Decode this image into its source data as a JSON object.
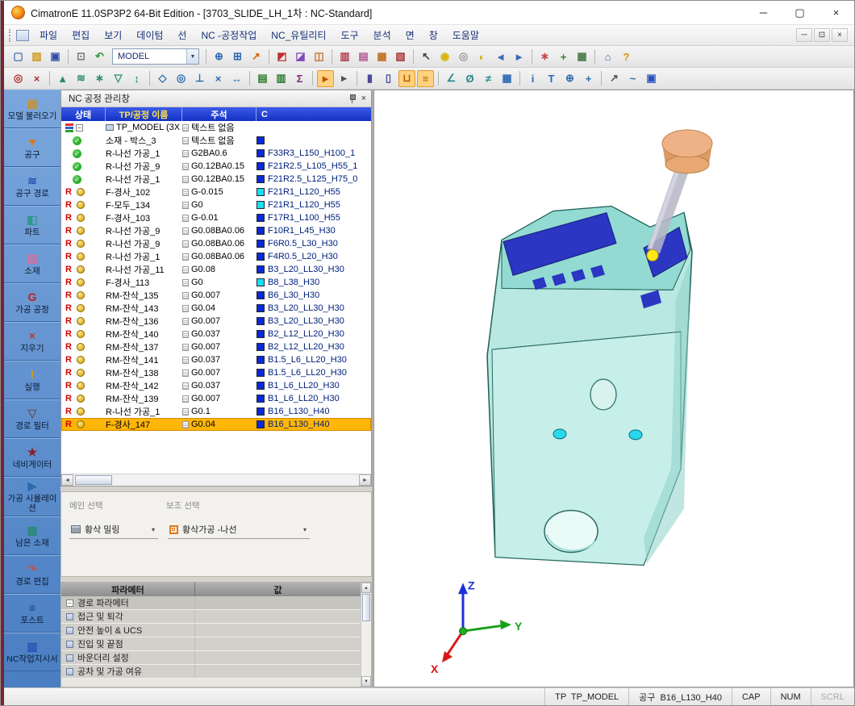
{
  "window": {
    "title": "CimatronE 11.0SP3P2 64-Bit Edition - [3703_SLIDE_LH_1차 : NC-Standard]"
  },
  "icons": {
    "minimize": "─",
    "maximize": "▢",
    "restore": "⊡",
    "close": "×",
    "dropdown": "▼",
    "dropdown_small": "▾",
    "left": "◄",
    "right": "►",
    "up": "▲",
    "down": "▼",
    "collapse": "−",
    "check": "✓"
  },
  "menu": {
    "items": [
      "파일",
      "편집",
      "보기",
      "데이텀",
      "선",
      "NC -공정작업",
      "NC_유틸리티",
      "도구",
      "분석",
      "면",
      "창",
      "도움말"
    ]
  },
  "toolbars": {
    "model_value": "MODEL",
    "row1": [
      {
        "n": "new-file-icon",
        "g": "▢",
        "c": "#4a6fb5"
      },
      {
        "n": "open-file-icon",
        "g": "▨",
        "c": "#d09818"
      },
      {
        "n": "save-icon",
        "g": "▣",
        "c": "#2e4fa8"
      },
      {
        "sep": true
      },
      {
        "n": "print-icon",
        "g": "⊡",
        "c": "#777777"
      },
      {
        "n": "undo-icon",
        "g": "↶",
        "c": "#2f9e3f"
      },
      {
        "combo": true
      },
      {
        "sep": true
      },
      {
        "n": "zoom-fit-icon",
        "g": "⊕",
        "c": "#2a6ab0"
      },
      {
        "n": "zoom-window-icon",
        "g": "⊞",
        "c": "#2a6ab0"
      },
      {
        "n": "zoom-dynamic-icon",
        "g": "↗",
        "c": "#d06a10"
      },
      {
        "sep": true
      },
      {
        "n": "sketcher-icon",
        "g": "◩",
        "c": "#c03030"
      },
      {
        "n": "shading-icon",
        "g": "◪",
        "c": "#8048b8"
      },
      {
        "n": "wireframe-icon",
        "g": "◫",
        "c": "#c86a20"
      },
      {
        "sep": true
      },
      {
        "n": "display-mode-icon",
        "g": "▥",
        "c": "#b03848"
      },
      {
        "n": "section-view-icon",
        "g": "▤",
        "c": "#b05890"
      },
      {
        "n": "clip-plane-icon",
        "g": "▦",
        "c": "#c07020"
      },
      {
        "n": "render-icon",
        "g": "▧",
        "c": "#a83030"
      },
      {
        "sep": true
      },
      {
        "n": "pick-arrow-icon",
        "g": "↖",
        "c": "#444444"
      },
      {
        "n": "light-on-icon",
        "g": "◉",
        "c": "#d8b000"
      },
      {
        "n": "light-off-icon",
        "g": "◎",
        "c": "#9a9a9a"
      },
      {
        "n": "light-partial-icon",
        "g": "◐",
        "c": "#d8b000"
      },
      {
        "n": "prev-view-icon",
        "g": "◄",
        "c": "#3a6ab5"
      },
      {
        "n": "next-view-icon",
        "g": "►",
        "c": "#3a6ab5"
      },
      {
        "sep": true
      },
      {
        "n": "datum-points-icon",
        "g": "∗",
        "c": "#c04040"
      },
      {
        "n": "ucs-icon",
        "g": "+",
        "c": "#3a7a3a"
      },
      {
        "n": "grid-icon",
        "g": "▦",
        "c": "#4a7a4a"
      },
      {
        "sep": true
      },
      {
        "n": "home-view-icon",
        "g": "⌂",
        "c": "#3a6ab5"
      },
      {
        "n": "help-icon",
        "g": "?",
        "c": "#d89a00"
      }
    ],
    "row2": [
      {
        "n": "select-all-icon",
        "g": "◎",
        "c": "#b03030"
      },
      {
        "n": "deselect-icon",
        "g": "×",
        "c": "#b03030"
      },
      {
        "sep": true
      },
      {
        "n": "add-faces-icon",
        "g": "▲",
        "c": "#2a8a6a"
      },
      {
        "n": "add-curves-icon",
        "g": "≋",
        "c": "#2a8a6a"
      },
      {
        "n": "add-points-icon",
        "g": "∗",
        "c": "#2a8a6a"
      },
      {
        "n": "remove-entity-icon",
        "g": "▽",
        "c": "#2a8a6a"
      },
      {
        "n": "flip-normal-icon",
        "g": "↕",
        "c": "#2a8a6a"
      },
      {
        "sep": true
      },
      {
        "n": "boundary-icon",
        "g": "◇",
        "c": "#2a6ab0"
      },
      {
        "n": "offset-icon",
        "g": "◎",
        "c": "#2a6ab0"
      },
      {
        "n": "project-icon",
        "g": "⊥",
        "c": "#2a6ab0"
      },
      {
        "n": "trim-icon",
        "g": "×",
        "c": "#2a6ab0"
      },
      {
        "n": "extend-icon",
        "g": "↔",
        "c": "#2a6ab0"
      },
      {
        "sep": true
      },
      {
        "n": "new-toolpath-icon",
        "g": "▤",
        "c": "#2a7a2a"
      },
      {
        "n": "edit-toolpath-icon",
        "g": "▥",
        "c": "#2a7a2a"
      },
      {
        "n": "calculate-icon",
        "g": "Σ",
        "c": "#7a2a7a"
      },
      {
        "sep": true
      },
      {
        "n": "simulate-icon",
        "g": "►",
        "c": "#c05000",
        "a": true
      },
      {
        "n": "step-icon",
        "g": "▸",
        "c": "#555555"
      },
      {
        "sep": true
      },
      {
        "n": "holder-icon",
        "g": "▮",
        "c": "#4a4a9a"
      },
      {
        "n": "show-tool-icon",
        "g": "▯",
        "c": "#4a4a9a"
      },
      {
        "n": "machine-sim-icon",
        "g": "⊔",
        "c": "#c06000",
        "a": true
      },
      {
        "n": "gcode-icon",
        "g": "≡",
        "c": "#c06000",
        "a": true
      },
      {
        "sep": true
      },
      {
        "n": "angle-analysis-icon",
        "g": "∠",
        "c": "#2a8a8a"
      },
      {
        "n": "measure-icon",
        "g": "Ø",
        "c": "#2a8a8a"
      },
      {
        "n": "compare-icon",
        "g": "≠",
        "c": "#2a8a8a"
      },
      {
        "n": "report-icon",
        "g": "▦",
        "c": "#2a6ab0"
      },
      {
        "sep": true
      },
      {
        "n": "info-icon",
        "g": "i",
        "c": "#2a6ab0"
      },
      {
        "n": "tool-table-icon",
        "g": "T",
        "c": "#2a6ab0"
      },
      {
        "n": "origin-icon",
        "g": "⊕",
        "c": "#2a6ab0"
      },
      {
        "n": "ucs-manager-icon",
        "g": "+",
        "c": "#2a6ab0"
      },
      {
        "sep": true
      },
      {
        "n": "edit-sketch-icon",
        "g": "↗",
        "c": "#555555"
      },
      {
        "n": "curve-icon",
        "g": "~",
        "c": "#2a6ab0"
      },
      {
        "n": "solid-icon",
        "g": "▣",
        "c": "#2a50c0"
      }
    ]
  },
  "sidebar": {
    "items": [
      {
        "id": "model-load",
        "label": "모델 불러오기",
        "glyph": "▤",
        "color": "#d09018"
      },
      {
        "id": "tool",
        "label": "공구",
        "glyph": "▼",
        "color": "#e07818"
      },
      {
        "id": "toolpath",
        "label": "공구 경로",
        "glyph": "≋",
        "color": "#2a50b0"
      },
      {
        "id": "part",
        "label": "파트",
        "glyph": "◧",
        "color": "#2a9a8a"
      },
      {
        "id": "stock",
        "label": "소재",
        "glyph": "▨",
        "color": "#d070a0"
      },
      {
        "id": "nc-process",
        "label": "가공 공정",
        "glyph": "G",
        "color": "#c02020"
      },
      {
        "id": "delete",
        "label": "지우기",
        "glyph": "×",
        "color": "#c03030"
      },
      {
        "id": "execute",
        "label": "실행",
        "glyph": "!",
        "color": "#d8a000"
      },
      {
        "id": "path-filter",
        "label": "경로 필터",
        "glyph": "▽",
        "color": "#5a5a5a"
      },
      {
        "id": "navigator",
        "label": "네비게이터",
        "glyph": "★",
        "color": "#8a2030"
      },
      {
        "id": "simulation",
        "label": "가공 시뮬레이션",
        "glyph": "▶",
        "color": "#2a6ab0"
      },
      {
        "id": "rest-material",
        "label": "남은 소재",
        "glyph": "▩",
        "color": "#2a8a7a"
      },
      {
        "id": "path-edit",
        "label": "경로 편집",
        "glyph": "↷",
        "color": "#c05050"
      },
      {
        "id": "post",
        "label": "포스트",
        "glyph": "≡",
        "color": "#203a8a"
      },
      {
        "id": "nc-report",
        "label": "NC작업지시서",
        "glyph": "▥",
        "color": "#2a50b0"
      }
    ]
  },
  "nc_panel": {
    "title": "NC 공정 관리창",
    "columns": [
      "상태",
      "TP/공정 이름",
      "주석",
      "C"
    ],
    "r_flag": "R",
    "swatch_blue": "#0a2ad8",
    "swatch_cyan": "#18e0f0",
    "rows": [
      {
        "st": "job",
        "name": "TP_MODEL (3X",
        "comment": "텍스트 없음",
        "swatch": "",
        "tool": ""
      },
      {
        "st": "ok",
        "name": "소재 - 박스_3",
        "comment": "텍스트 없음",
        "swatch": "blue",
        "tool": ""
      },
      {
        "st": "ok",
        "name": "R-나선 가공_1",
        "comment": "G2BA0.6",
        "swatch": "blue",
        "tool": "F33R3_L150_H100_1"
      },
      {
        "st": "ok",
        "name": "R-나선 가공_9",
        "comment": "G0.12BA0.15",
        "swatch": "blue",
        "tool": "F21R2.5_L105_H55_1"
      },
      {
        "st": "ok",
        "name": "R-나선 가공_1",
        "comment": "G0.12BA0.15",
        "swatch": "blue",
        "tool": "F21R2.5_L125_H75_0"
      },
      {
        "st": "r",
        "name": "F-경사_102",
        "comment": "G-0.015",
        "swatch": "cyan",
        "tool": "F21R1_L120_H55"
      },
      {
        "st": "r",
        "name": "F-모두_134",
        "comment": "G0",
        "swatch": "cyan",
        "tool": "F21R1_L120_H55"
      },
      {
        "st": "r",
        "name": "F-경사_103",
        "comment": "G-0.01",
        "swatch": "blue",
        "tool": "F17R1_L100_H55"
      },
      {
        "st": "r",
        "name": "R-나선 가공_9",
        "comment": "G0.08BA0.06",
        "swatch": "blue",
        "tool": "F10R1_L45_H30"
      },
      {
        "st": "r",
        "name": "R-나선 가공_9",
        "comment": "G0.08BA0.06",
        "swatch": "blue",
        "tool": "F6R0.5_L30_H30"
      },
      {
        "st": "r",
        "name": "R-나선 가공_1",
        "comment": "G0.08BA0.06",
        "swatch": "blue",
        "tool": "F4R0.5_L20_H30"
      },
      {
        "st": "r",
        "name": "R-나선 가공_11",
        "comment": "G0.08",
        "swatch": "blue",
        "tool": "B3_L20_LL30_H30"
      },
      {
        "st": "r",
        "name": "F-경사_113",
        "comment": "G0",
        "swatch": "cyan",
        "tool": "B8_L38_H30"
      },
      {
        "st": "r",
        "name": "RM-잔삭_135",
        "comment": "G0.007",
        "swatch": "blue",
        "tool": "B6_L30_H30"
      },
      {
        "st": "r",
        "name": "RM-잔삭_143",
        "comment": "G0.04",
        "swatch": "blue",
        "tool": "B3_L20_LL30_H30"
      },
      {
        "st": "r",
        "name": "RM-잔삭_136",
        "comment": "G0.007",
        "swatch": "blue",
        "tool": "B3_L20_LL30_H30"
      },
      {
        "st": "r",
        "name": "RM-잔삭_140",
        "comment": "G0.037",
        "swatch": "blue",
        "tool": "B2_L12_LL20_H30"
      },
      {
        "st": "r",
        "name": "RM-잔삭_137",
        "comment": "G0.007",
        "swatch": "blue",
        "tool": "B2_L12_LL20_H30"
      },
      {
        "st": "r",
        "name": "RM-잔삭_141",
        "comment": "G0.037",
        "swatch": "blue",
        "tool": "B1.5_L6_LL20_H30"
      },
      {
        "st": "r",
        "name": "RM-잔삭_138",
        "comment": "G0.007",
        "swatch": "blue",
        "tool": "B1.5_L6_LL20_H30"
      },
      {
        "st": "r",
        "name": "RM-잔삭_142",
        "comment": "G0.037",
        "swatch": "blue",
        "tool": "B1_L6_LL20_H30"
      },
      {
        "st": "r",
        "name": "RM-잔삭_139",
        "comment": "G0.007",
        "swatch": "blue",
        "tool": "B1_L6_LL20_H30"
      },
      {
        "st": "r",
        "name": "R-나선 가공_1",
        "comment": "G0.1",
        "swatch": "blue",
        "tool": "B16_L130_H40"
      },
      {
        "st": "r",
        "name": "F-경사_147",
        "comment": "G0.04",
        "swatch": "blue",
        "tool": "B16_L130_H40",
        "hl": true
      }
    ]
  },
  "selection_panel": {
    "main_label": "메인 선택",
    "aux_label": "보조 선택",
    "main_value": "황삭 밀링",
    "aux_value": "황삭가공 -나선"
  },
  "parameters": {
    "col_param": "파라메터",
    "col_value": "값",
    "rows": [
      {
        "label": "경로 파라메터",
        "group": true
      },
      {
        "label": "접근 및 퇴각"
      },
      {
        "label": "안전 높이 & UCS"
      },
      {
        "label": "진입 및 끝점"
      },
      {
        "label": "바운더리 설정"
      },
      {
        "label": "공차 및 가공 여유"
      }
    ]
  },
  "viewport": {
    "axes": {
      "x": "X",
      "y": "Y",
      "z": "Z"
    }
  },
  "statusbar": {
    "tp": "TP  TP_MODEL",
    "tool": "공구  B16_L130_H40",
    "cap": "CAP",
    "num": "NUM",
    "scrl": "SCRL"
  }
}
